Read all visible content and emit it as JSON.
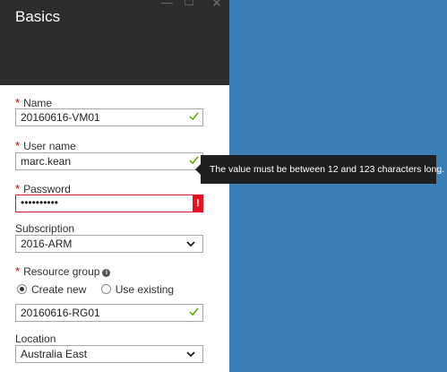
{
  "blade": {
    "title": "Basics",
    "window_controls": {
      "minimize": "—",
      "maximize": "☐",
      "close": "✕"
    }
  },
  "form": {
    "name": {
      "label": "Name",
      "value": "20160616-VM01",
      "required": true,
      "valid": true
    },
    "username": {
      "label": "User name",
      "value": "marc.kean",
      "required": true,
      "valid": true
    },
    "password": {
      "label": "Password",
      "value": "••••••••••",
      "required": true,
      "error_icon": "!"
    },
    "subscription": {
      "label": "Subscription",
      "value": "2016-ARM"
    },
    "resource_group": {
      "label": "Resource group",
      "required": true,
      "info_icon": "i",
      "options": [
        "Create new",
        "Use existing"
      ],
      "selected": "Create new",
      "value": "20160616-RG01"
    },
    "location": {
      "label": "Location",
      "value": "Australia East"
    }
  },
  "tooltip": {
    "text": "The value must be between 12 and 123 characters long."
  },
  "colors": {
    "header": "#2d2d2d",
    "background": "#3a7fb8",
    "error": "#e81123",
    "valid": "#57a300"
  }
}
